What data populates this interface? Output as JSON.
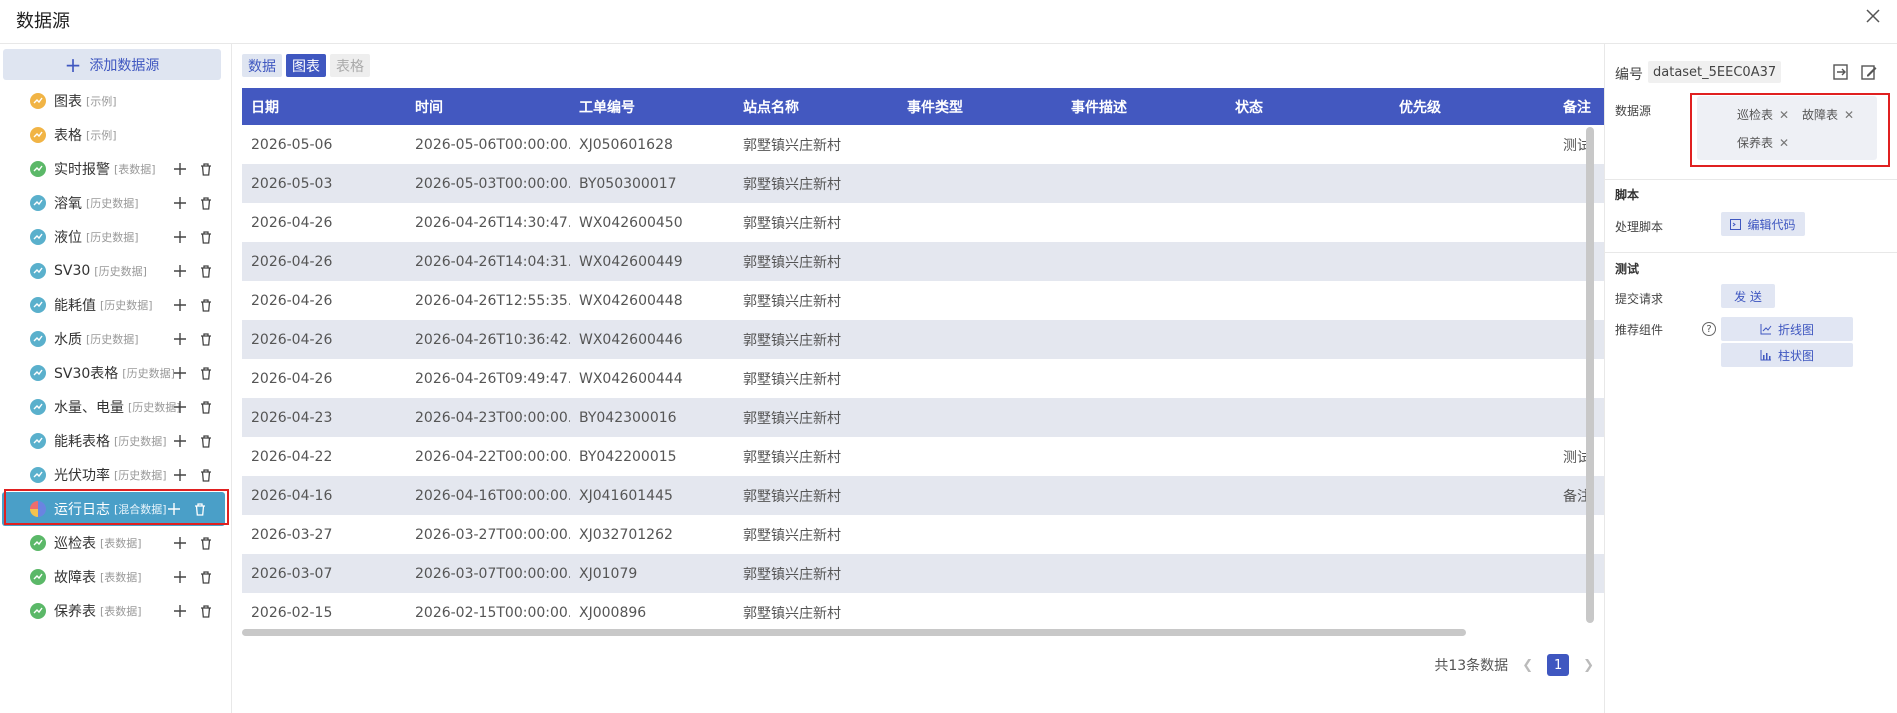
{
  "header": {
    "title": "数据源"
  },
  "sidebar": {
    "add_label": "添加数据源",
    "items": [
      {
        "name": "图表",
        "tag": "[示例]",
        "color": "orange",
        "actions": false
      },
      {
        "name": "表格",
        "tag": "[示例]",
        "color": "orange",
        "actions": false
      },
      {
        "name": "实时报警",
        "tag": "[表数据]",
        "color": "green",
        "actions": true
      },
      {
        "name": "溶氧",
        "tag": "[历史数据]",
        "color": "teal",
        "actions": true
      },
      {
        "name": "液位",
        "tag": "[历史数据]",
        "color": "teal",
        "actions": true
      },
      {
        "name": "SV30",
        "tag": "[历史数据]",
        "color": "teal",
        "actions": true
      },
      {
        "name": "能耗值",
        "tag": "[历史数据]",
        "color": "teal",
        "actions": true
      },
      {
        "name": "水质",
        "tag": "[历史数据]",
        "color": "teal",
        "actions": true
      },
      {
        "name": "SV30表格",
        "tag": "[历史数据]",
        "color": "teal",
        "actions": true
      },
      {
        "name": "水量、电量",
        "tag": "[历史数据]",
        "color": "teal",
        "actions": true
      },
      {
        "name": "能耗表格",
        "tag": "[历史数据]",
        "color": "teal",
        "actions": true
      },
      {
        "name": "光伏功率",
        "tag": "[历史数据]",
        "color": "teal",
        "actions": true
      },
      {
        "name": "运行日志",
        "tag": "[混合数据]",
        "color": "pie",
        "actions": true,
        "active": true
      },
      {
        "name": "巡检表",
        "tag": "[表数据]",
        "color": "green",
        "actions": true
      },
      {
        "name": "故障表",
        "tag": "[表数据]",
        "color": "green",
        "actions": true
      },
      {
        "name": "保养表",
        "tag": "[表数据]",
        "color": "green",
        "actions": true
      }
    ]
  },
  "tabs": [
    {
      "label": "数据",
      "state": "normal"
    },
    {
      "label": "图表",
      "state": "active"
    },
    {
      "label": "表格",
      "state": "disabled"
    }
  ],
  "table": {
    "columns": [
      "日期",
      "时间",
      "工单编号",
      "站点名称",
      "事件类型",
      "事件描述",
      "状态",
      "优先级",
      "备注"
    ],
    "rows": [
      [
        "2026-05-06",
        "2026-05-06T00:00:00...",
        "XJ050601628",
        "郭墅镇兴庄新村",
        "",
        "",
        "",
        "",
        "测试"
      ],
      [
        "2026-05-03",
        "2026-05-03T00:00:00...",
        "BY050300017",
        "郭墅镇兴庄新村",
        "",
        "",
        "",
        "",
        ""
      ],
      [
        "2026-04-26",
        "2026-04-26T14:30:47...",
        "WX042600450",
        "郭墅镇兴庄新村",
        "",
        "",
        "",
        "",
        ""
      ],
      [
        "2026-04-26",
        "2026-04-26T14:04:31...",
        "WX042600449",
        "郭墅镇兴庄新村",
        "",
        "",
        "",
        "",
        ""
      ],
      [
        "2026-04-26",
        "2026-04-26T12:55:35...",
        "WX042600448",
        "郭墅镇兴庄新村",
        "",
        "",
        "",
        "",
        ""
      ],
      [
        "2026-04-26",
        "2026-04-26T10:36:42...",
        "WX042600446",
        "郭墅镇兴庄新村",
        "",
        "",
        "",
        "",
        ""
      ],
      [
        "2026-04-26",
        "2026-04-26T09:49:47...",
        "WX042600444",
        "郭墅镇兴庄新村",
        "",
        "",
        "",
        "",
        ""
      ],
      [
        "2026-04-23",
        "2026-04-23T00:00:00...",
        "BY042300016",
        "郭墅镇兴庄新村",
        "",
        "",
        "",
        "",
        ""
      ],
      [
        "2026-04-22",
        "2026-04-22T00:00:00...",
        "BY042200015",
        "郭墅镇兴庄新村",
        "",
        "",
        "",
        "",
        "测试"
      ],
      [
        "2026-04-16",
        "2026-04-16T00:00:00...",
        "XJ041601445",
        "郭墅镇兴庄新村",
        "",
        "",
        "",
        "",
        "备注"
      ],
      [
        "2026-03-27",
        "2026-03-27T00:00:00...",
        "XJ032701262",
        "郭墅镇兴庄新村",
        "",
        "",
        "",
        "",
        ""
      ],
      [
        "2026-03-07",
        "2026-03-07T00:00:00...",
        "XJ01079",
        "郭墅镇兴庄新村",
        "",
        "",
        "",
        "",
        ""
      ],
      [
        "2026-02-15",
        "2026-02-15T00:00:00...",
        "XJ000896",
        "郭墅镇兴庄新村",
        "",
        "",
        "",
        "",
        ""
      ]
    ]
  },
  "pagination": {
    "total_label": "共13条数据",
    "current_page": "1"
  },
  "panel": {
    "id_label": "编号",
    "id_value": "dataset_5EEC0A37",
    "datasource_label": "数据源",
    "datasource_help": "?",
    "datasource_tags": [
      "巡检表",
      "故障表",
      "保养表"
    ],
    "tag_remove": "✕",
    "script_section": "脚本",
    "script_label": "处理脚本",
    "edit_code_label": "编辑代码",
    "test_section": "测试",
    "submit_label": "提交请求",
    "send_label": "发 送",
    "recommend_label": "推荐组件",
    "recommend_help": "?",
    "line_chart_label": "折线图",
    "bar_chart_label": "柱状图"
  },
  "colors": {
    "primary": "#3f57c0",
    "header_bg": "#4358c0",
    "active_item": "#4a9fc8",
    "highlight": "#e02020"
  }
}
